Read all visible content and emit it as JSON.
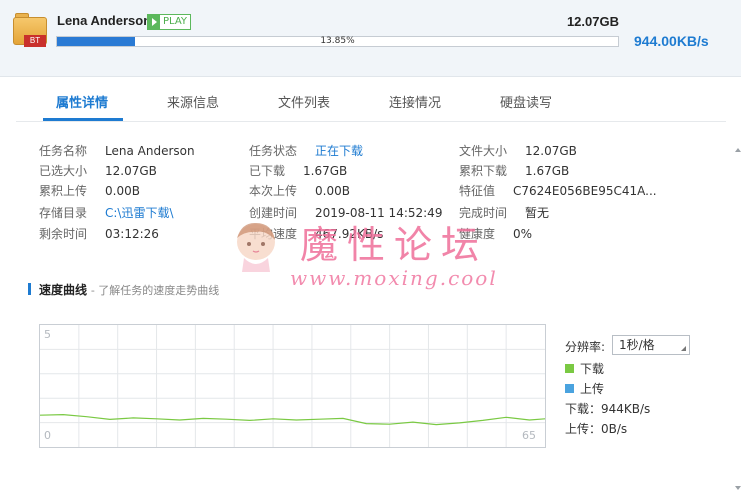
{
  "header": {
    "task_name": "Lena Anderson",
    "play_label": "PLAY",
    "file_badge": "BT",
    "total_size": "12.07GB",
    "progress_text": "13.85%",
    "progress_fraction": 0.1385,
    "speed": "944.00KB/s"
  },
  "tabs": [
    {
      "label": "属性详情",
      "active": true
    },
    {
      "label": "来源信息",
      "active": false
    },
    {
      "label": "文件列表",
      "active": false
    },
    {
      "label": "连接情况",
      "active": false
    },
    {
      "label": "硬盘读写",
      "active": false
    }
  ],
  "info": {
    "col1": [
      {
        "label": "任务名称",
        "value": "Lena Anderson"
      },
      {
        "label": "已选大小",
        "value": "12.07GB"
      },
      {
        "label": "累积上传",
        "value": "0.00B"
      },
      {
        "label": "存储目录",
        "value": "C:\\迅雷下载\\"
      },
      {
        "label": "剩余时间",
        "value": "03:12:26"
      }
    ],
    "col2": [
      {
        "label": "任务状态",
        "value": "正在下载"
      },
      {
        "label": "已下载",
        "value": "1.67GB"
      },
      {
        "label": "本次上传",
        "value": "0.00B"
      },
      {
        "label": "创建时间",
        "value": "2019-08-11 14:52:49"
      },
      {
        "label": "平均速度",
        "value": "467.92KB/s"
      }
    ],
    "col3": [
      {
        "label": "文件大小",
        "value": "12.07GB"
      },
      {
        "label": "累积下载",
        "value": "1.67GB"
      },
      {
        "label": "特征值",
        "value": "C7624E056BE95C41A..."
      },
      {
        "label": "完成时间",
        "value": "暂无"
      },
      {
        "label": "健康度",
        "value": "0%"
      }
    ]
  },
  "watermark": {
    "text": "魔性论坛",
    "url": "www.moxing.cool"
  },
  "speed_section": {
    "title": "速度曲线",
    "subtitle": "- 了解任务的速度走势曲线",
    "resolution_label": "分辨率:",
    "resolution_value": "1秒/格",
    "legend_download": "下载",
    "legend_upload": "上传",
    "download_stat": "下载：944KB/s",
    "upload_stat": "上传：0B/s",
    "download_color": "#7ac943",
    "upload_color": "#4aa3df"
  },
  "chart_data": {
    "type": "line",
    "y_top_label": "5",
    "y_bottom_label": "0",
    "x_end_label": "65",
    "ylim": [
      0,
      5
    ],
    "xlim": [
      0,
      65
    ],
    "grid": true,
    "series": [
      {
        "name": "下载",
        "color": "#7ac943",
        "x": [
          0,
          3,
          6,
          9,
          12,
          15,
          18,
          21,
          24,
          27,
          30,
          33,
          36,
          39,
          42,
          45,
          48,
          51,
          54,
          57,
          60,
          63,
          65
        ],
        "values": [
          0.95,
          0.98,
          0.88,
          0.75,
          0.82,
          0.78,
          0.72,
          0.8,
          0.76,
          0.7,
          0.78,
          0.72,
          0.76,
          0.8,
          0.55,
          0.52,
          0.62,
          0.5,
          0.58,
          0.7,
          0.85,
          0.72,
          0.78
        ]
      },
      {
        "name": "上传",
        "color": "#4aa3df",
        "x": [
          0,
          65
        ],
        "values": [
          0,
          0
        ]
      }
    ]
  }
}
